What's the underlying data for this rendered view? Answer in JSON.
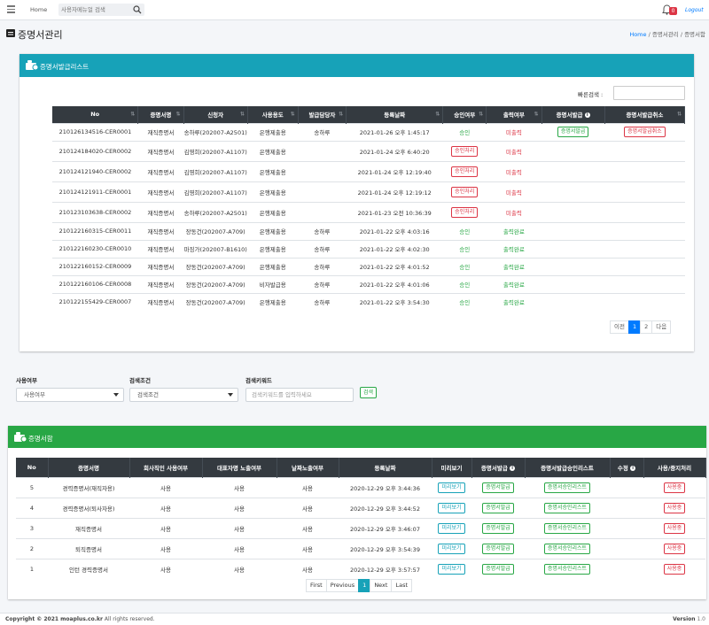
{
  "nav": {
    "home": "Home",
    "search_placeholder": "사용자메뉴얼 검색",
    "notif_count": "0",
    "logout": "Logout"
  },
  "page": {
    "title": "증명서관리",
    "breadcrumb_home": "Home",
    "breadcrumb_rest": "/ 증명서관리 / 증명서함"
  },
  "issue_list": {
    "title": "증명서발급리스트",
    "quick_search_label": "빠른검색 :",
    "columns": [
      "No",
      "증명서명",
      "신청자",
      "사용용도",
      "발급담당자",
      "등록날짜",
      "승인여부",
      "출력여부",
      "증명서발급",
      "증명서발급취소"
    ],
    "rows": [
      {
        "no": "210126134516-CER0001",
        "name": "재직증명서",
        "applicant": "송하루(202007-A2501)",
        "purpose": "은행제출용",
        "manager": "송하루",
        "date": "2021-01-26 오후 1:45:17",
        "approval": "승인",
        "approval_type": "text-green",
        "print": "미출력",
        "print_type": "red",
        "issue": "증명서발급",
        "cancel": "증명서발급취소"
      },
      {
        "no": "210124184020-CER0002",
        "name": "재직증명서",
        "applicant": "김영희(202007-A1107)",
        "purpose": "은행제출용",
        "manager": "",
        "date": "2021-01-24 오후 6:40:20",
        "approval": "승인처리",
        "approval_type": "btn",
        "print": "미출력",
        "print_type": "red",
        "issue": "",
        "cancel": ""
      },
      {
        "no": "210124121940-CER0002",
        "name": "재직증명서",
        "applicant": "김영희(202007-A1107)",
        "purpose": "은행제출용",
        "manager": "",
        "date": "2021-01-24 오후 12:19:40",
        "approval": "승인처리",
        "approval_type": "btn",
        "print": "미출력",
        "print_type": "red",
        "issue": "",
        "cancel": ""
      },
      {
        "no": "210124121911-CER0001",
        "name": "재직증명서",
        "applicant": "김영희(202007-A1107)",
        "purpose": "은행제출용",
        "manager": "",
        "date": "2021-01-24 오후 12:19:12",
        "approval": "승인처리",
        "approval_type": "btn",
        "print": "미출력",
        "print_type": "red",
        "issue": "",
        "cancel": ""
      },
      {
        "no": "210123103638-CER0002",
        "name": "재직증명서",
        "applicant": "송하루(202007-A2501)",
        "purpose": "은행제출용",
        "manager": "",
        "date": "2021-01-23 오전 10:36:39",
        "approval": "승인처리",
        "approval_type": "btn",
        "print": "미출력",
        "print_type": "red",
        "issue": "",
        "cancel": ""
      },
      {
        "no": "210122160315-CER0011",
        "name": "재직증명서",
        "applicant": "장동건(202007-A709)",
        "purpose": "은행제출용",
        "manager": "송하루",
        "date": "2021-01-22 오후 4:03:16",
        "approval": "승인",
        "approval_type": "text-green",
        "print": "출력완료",
        "print_type": "green",
        "issue": "",
        "cancel": ""
      },
      {
        "no": "210122160230-CER0010",
        "name": "재직증명서",
        "applicant": "마징가(202007-B1610)",
        "purpose": "은행제출용",
        "manager": "송하루",
        "date": "2021-01-22 오후 4:02:30",
        "approval": "승인",
        "approval_type": "text-green",
        "print": "출력완료",
        "print_type": "green",
        "issue": "",
        "cancel": ""
      },
      {
        "no": "210122160152-CER0009",
        "name": "재직증명서",
        "applicant": "장동건(202007-A709)",
        "purpose": "은행제출용",
        "manager": "송하루",
        "date": "2021-01-22 오후 4:01:52",
        "approval": "승인",
        "approval_type": "text-green",
        "print": "출력완료",
        "print_type": "green",
        "issue": "",
        "cancel": ""
      },
      {
        "no": "210122160106-CER0008",
        "name": "재직증명서",
        "applicant": "장동건(202007-A709)",
        "purpose": "비자발급용",
        "manager": "송하루",
        "date": "2021-01-22 오후 4:01:06",
        "approval": "승인",
        "approval_type": "text-green",
        "print": "출력완료",
        "print_type": "green",
        "issue": "",
        "cancel": ""
      },
      {
        "no": "210122155429-CER0007",
        "name": "재직증명서",
        "applicant": "장동건(202007-A709)",
        "purpose": "은행제출용",
        "manager": "송하루",
        "date": "2021-01-22 오후 3:54:30",
        "approval": "승인",
        "approval_type": "text-green",
        "print": "출력완료",
        "print_type": "green",
        "issue": "",
        "cancel": ""
      }
    ],
    "pagination": {
      "prev": "이전",
      "pages": [
        "1",
        "2"
      ],
      "active": "1",
      "next": "다음"
    }
  },
  "filters": {
    "use_label": "사용여부",
    "use_value": "사용여부",
    "cond_label": "검색조건",
    "cond_value": "검색조건",
    "keyword_label": "검색키워드",
    "keyword_placeholder": "검색키워드를 입력하세요",
    "search_button": "검색"
  },
  "cert_box": {
    "title": "증명서함",
    "columns": [
      "No",
      "증명서명",
      "회사직인 사용여부",
      "대표자명 노출여부",
      "날짜노출여부",
      "등록날짜",
      "미리보기",
      "증명서발급",
      "증명서발급승인리스트",
      "수정",
      "사용/중지처리"
    ],
    "rows": [
      {
        "no": "5",
        "name": "경력증명서(재직자용)",
        "seal": "사용",
        "rep": "사용",
        "date_show": "사용",
        "date": "2020-12-29 오후 3:44:36",
        "preview": "미리보기",
        "issue": "증명서발급",
        "approval_list": "증명서승인리스트",
        "edit": "",
        "toggle": "사용중"
      },
      {
        "no": "4",
        "name": "경력증명서(퇴사자용)",
        "seal": "사용",
        "rep": "사용",
        "date_show": "사용",
        "date": "2020-12-29 오후 3:44:52",
        "preview": "미리보기",
        "issue": "증명서발급",
        "approval_list": "증명서승인리스트",
        "edit": "",
        "toggle": "사용중"
      },
      {
        "no": "3",
        "name": "재직증명서",
        "seal": "사용",
        "rep": "사용",
        "date_show": "사용",
        "date": "2020-12-29 오후 3:46:07",
        "preview": "미리보기",
        "issue": "증명서발급",
        "approval_list": "증명서승인리스트",
        "edit": "",
        "toggle": "사용중"
      },
      {
        "no": "2",
        "name": "퇴직증명서",
        "seal": "사용",
        "rep": "사용",
        "date_show": "사용",
        "date": "2020-12-29 오후 3:54:39",
        "preview": "미리보기",
        "issue": "증명서발급",
        "approval_list": "증명서승인리스트",
        "edit": "",
        "toggle": "사용중"
      },
      {
        "no": "1",
        "name": "인턴 경력증명서",
        "seal": "사용",
        "rep": "사용",
        "date_show": "사용",
        "date": "2020-12-29 오후 3:57:57",
        "preview": "미리보기",
        "issue": "증명서발급",
        "approval_list": "증명서승인리스트",
        "edit": "",
        "toggle": "사용중"
      }
    ],
    "pagination": {
      "first": "First",
      "previous": "Previous",
      "active": "1",
      "next": "Next",
      "last": "Last"
    }
  },
  "footer": {
    "copyright_bold": "Copyright © 2021 moaplus.co.kr",
    "copyright_rest": " All rights reserved.",
    "version_label": "Version",
    "version_value": "1.0"
  },
  "colors": {
    "teal": "#17a2b8",
    "green": "#28a745",
    "dark": "#343a40",
    "red": "#dc3545",
    "blue": "#007bff"
  }
}
